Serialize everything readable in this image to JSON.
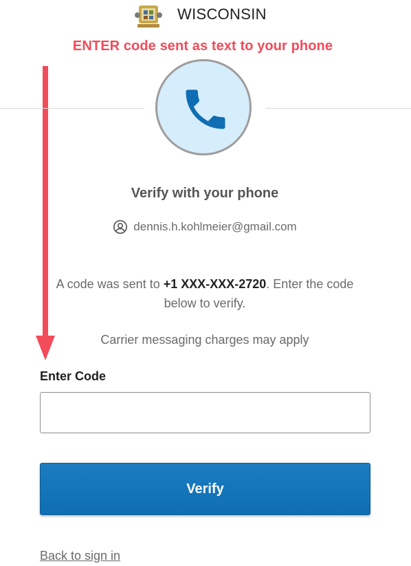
{
  "header": {
    "brand": "WISCONSIN",
    "seal_icon": "wisconsin-state-seal-icon"
  },
  "annotation": {
    "text": "ENTER code sent as text to your phone",
    "color": "#f24b5a",
    "arrow_icon": "arrow-down-icon"
  },
  "verify": {
    "badge_icon": "phone-icon",
    "title": "Verify with your phone",
    "user_icon": "user-circle-icon",
    "email": "dennis.h.kohlmeier@gmail.com",
    "message_prefix": "A code was sent to ",
    "phone_number": "+1 XXX-XXX-2720",
    "message_suffix": ". Enter the code below to verify.",
    "carrier_note": "Carrier messaging charges may apply"
  },
  "form": {
    "code_label": "Enter Code",
    "code_value": "",
    "verify_label": "Verify",
    "back_link": "Back to sign in"
  },
  "colors": {
    "primary_button": "#1271b7",
    "badge_background": "#d6edfb",
    "phone_icon": "#0f6eb3"
  }
}
